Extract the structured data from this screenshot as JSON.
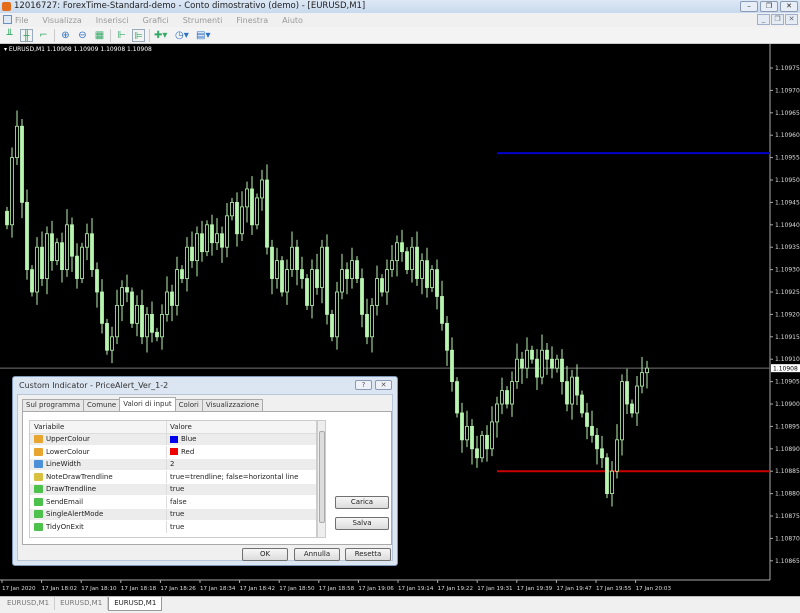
{
  "window": {
    "title": "12016727: ForexTime-Standard-demo - Conto dimostrativo (demo) - [EURUSD,M1]"
  },
  "menu": [
    "File",
    "Visualizza",
    "Inserisci",
    "Grafici",
    "Strumenti",
    "Finestra",
    "Aiuto"
  ],
  "toolbar": {
    "icons": [
      "bar-chart-icon",
      "candlestick-icon",
      "line-chart-icon",
      "zoom-in-icon",
      "zoom-out-icon",
      "tile-windows-icon",
      "chart-shift-icon",
      "autoscroll-icon",
      "indicators-icon",
      "periods-icon",
      "templates-icon"
    ],
    "right_icons": [
      "search-icon",
      "chat-icon"
    ]
  },
  "chart_data": {
    "type": "candlestick",
    "symbol_label": "EURUSD,M1  1.10908 1.10909 1.10908 1.10908",
    "current_price": "1.10908",
    "price_ticks": [
      "1.10975",
      "1.10970",
      "1.10965",
      "1.10960",
      "1.10955",
      "1.10950",
      "1.10945",
      "1.10940",
      "1.10935",
      "1.10930",
      "1.10925",
      "1.10920",
      "1.10915",
      "1.10910",
      "1.10905",
      "1.10900",
      "1.10895",
      "1.10890",
      "1.10885",
      "1.10880",
      "1.10875",
      "1.10870",
      "1.10865"
    ],
    "ylim": [
      1.10863,
      1.10982
    ],
    "time_ticks": [
      "17 Jan 2020",
      "17 Jan 18:02",
      "17 Jan 18:10",
      "17 Jan 18:18",
      "17 Jan 18:26",
      "17 Jan 18:34",
      "17 Jan 18:42",
      "17 Jan 18:50",
      "17 Jan 18:58",
      "17 Jan 19:06",
      "17 Jan 19:14",
      "17 Jan 19:22",
      "17 Jan 19:31",
      "17 Jan 19:39",
      "17 Jan 19:47",
      "17 Jan 19:55",
      "17 Jan 20:03"
    ],
    "upper_alert": 1.10956,
    "upper_color": "#0000cc",
    "lower_alert": 1.10885,
    "lower_color": "#cc0000",
    "candle_color": "#b8f5b0",
    "closes": [
      1.1094,
      1.10955,
      1.10962,
      1.10945,
      1.1093,
      1.10925,
      1.10935,
      1.10928,
      1.10938,
      1.10932,
      1.10936,
      1.1093,
      1.1094,
      1.10933,
      1.10928,
      1.10935,
      1.10938,
      1.1093,
      1.10925,
      1.10918,
      1.10912,
      1.10915,
      1.10922,
      1.10926,
      1.10925,
      1.10918,
      1.10922,
      1.10915,
      1.1092,
      1.10916,
      1.10915,
      1.1092,
      1.10925,
      1.10922,
      1.1093,
      1.10928,
      1.10935,
      1.10932,
      1.10938,
      1.10934,
      1.1094,
      1.10936,
      1.10938,
      1.10935,
      1.10942,
      1.10945,
      1.10938,
      1.10944,
      1.10948,
      1.1094,
      1.10946,
      1.1095,
      1.10935,
      1.10928,
      1.10932,
      1.10925,
      1.1093,
      1.10935,
      1.1093,
      1.10928,
      1.10922,
      1.1093,
      1.10926,
      1.10935,
      1.1092,
      1.10915,
      1.10925,
      1.1093,
      1.10928,
      1.10932,
      1.10928,
      1.1092,
      1.10915,
      1.10922,
      1.10928,
      1.10925,
      1.1093,
      1.10932,
      1.10936,
      1.10934,
      1.1093,
      1.10935,
      1.10928,
      1.10932,
      1.10926,
      1.1093,
      1.10924,
      1.10918,
      1.10912,
      1.10905,
      1.10898,
      1.10892,
      1.10895,
      1.1089,
      1.10888,
      1.10893,
      1.1089,
      1.10896,
      1.109,
      1.10903,
      1.109,
      1.10905,
      1.1091,
      1.10908,
      1.10912,
      1.1091,
      1.10906,
      1.10912,
      1.1091,
      1.10908,
      1.1091,
      1.10905,
      1.109,
      1.10906,
      1.10902,
      1.10898,
      1.10895,
      1.10893,
      1.1089,
      1.10888,
      1.1088,
      1.10885,
      1.10892,
      1.10905,
      1.109,
      1.10898,
      1.10904,
      1.10907,
      1.10908
    ]
  },
  "chart_tabs": [
    {
      "label": "EURUSD,M1",
      "active": false
    },
    {
      "label": "EURUSD,M1",
      "active": false
    },
    {
      "label": "EURUSD,M1",
      "active": true
    }
  ],
  "dialog": {
    "title": "Custom Indicator - PriceAlert_Ver_1-2",
    "tabs": [
      {
        "label": "Sul programma"
      },
      {
        "label": "Comune"
      },
      {
        "label": "Valori di input",
        "active": true
      },
      {
        "label": "Colori"
      },
      {
        "label": "Visualizzazione"
      }
    ],
    "columns": [
      "Variabile",
      "Valore"
    ],
    "rows": [
      {
        "name": "UpperColour",
        "value": "Blue",
        "type": "color",
        "swatch": "#0000ee"
      },
      {
        "name": "LowerColour",
        "value": "Red",
        "type": "color",
        "swatch": "#ee0000"
      },
      {
        "name": "LineWidth",
        "value": "2",
        "type": "int"
      },
      {
        "name": "NoteDrawTrendline",
        "value": "true=trendline; false=horizontal line",
        "type": "string"
      },
      {
        "name": "DrawTrendline",
        "value": "true",
        "type": "bool"
      },
      {
        "name": "SendEmail",
        "value": "false",
        "type": "bool"
      },
      {
        "name": "SingleAlertMode",
        "value": "true",
        "type": "bool"
      },
      {
        "name": "TidyOnExit",
        "value": "true",
        "type": "bool"
      }
    ],
    "buttons": {
      "load": "Carica",
      "save": "Salva",
      "ok": "OK",
      "cancel": "Annulla",
      "reset": "Resetta"
    }
  }
}
